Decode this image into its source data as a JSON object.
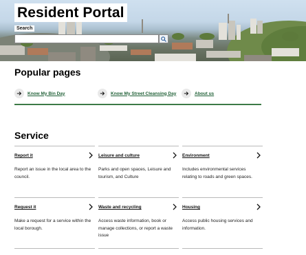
{
  "header": {
    "title": "Resident Portal",
    "search_label": "Search",
    "search_value": "",
    "search_icon": "search-icon"
  },
  "popular": {
    "heading": "Popular pages",
    "links": [
      {
        "label": "Know My Bin Day",
        "icon": "arrow-right-icon"
      },
      {
        "label": "Know My Street Cleansing Day",
        "icon": "arrow-right-icon"
      },
      {
        "label": "About us",
        "icon": "arrow-right-icon"
      }
    ],
    "rule_color": "#3c7a46",
    "link_color": "#1e5f35"
  },
  "service": {
    "heading": "Service",
    "cards": [
      {
        "title": "Report it",
        "description": "Report an issue in the local area to the council.",
        "icon": "chevron-right-icon"
      },
      {
        "title": "Leisure and culture",
        "description": "Parks and open spaces, Leisure and tourism, and Culture",
        "icon": "chevron-right-icon"
      },
      {
        "title": "Environment",
        "description": "Includes environmental services relating to roads and green spaces.",
        "icon": "chevron-right-icon"
      },
      {
        "title": "Request it",
        "description": "Make a request for a service within the local borough.",
        "icon": "chevron-right-icon"
      },
      {
        "title": "Waste and recycling",
        "description": "Access waste information, book or manage collections, or report a waste issue",
        "icon": "chevron-right-icon"
      },
      {
        "title": "Housing",
        "description": "Access public housing services and information.",
        "icon": "chevron-right-icon"
      }
    ]
  }
}
